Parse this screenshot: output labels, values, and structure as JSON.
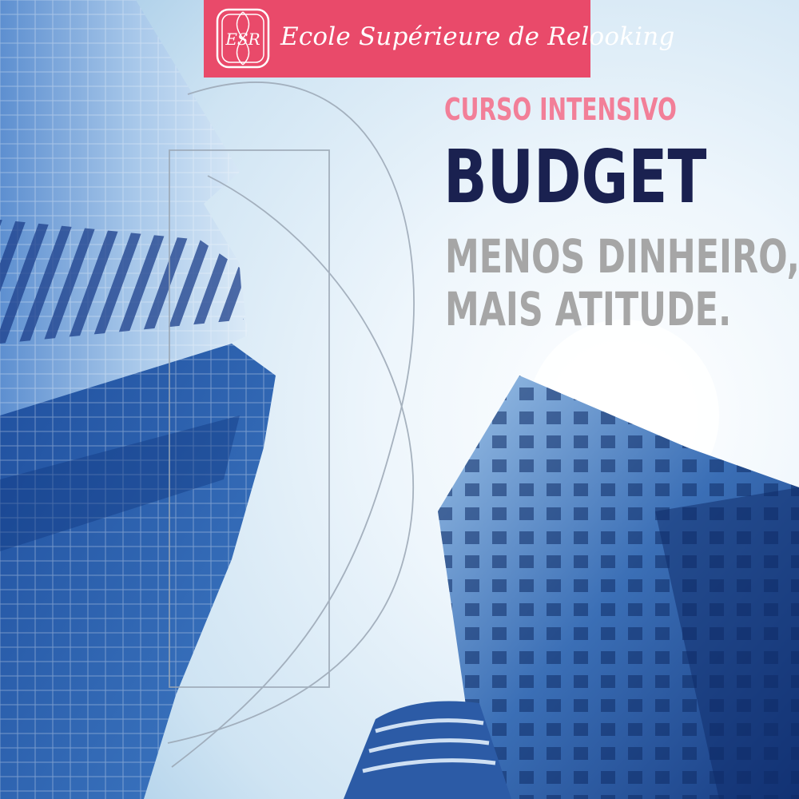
{
  "brand": {
    "name": "Ecole Supérieure de Relooking",
    "logo_monogram": "ESR",
    "color": "#e94a6a"
  },
  "headline": {
    "kicker": "CURSO INTENSIVO",
    "title": "BUDGET",
    "tagline_line1": "MENOS DINHEIRO,",
    "tagline_line2": "MAIS ATITUDE."
  },
  "colors": {
    "kicker": "#f27f98",
    "title": "#1a2150",
    "tagline": "#a6a6a6",
    "sky": "#e9f4fb"
  }
}
